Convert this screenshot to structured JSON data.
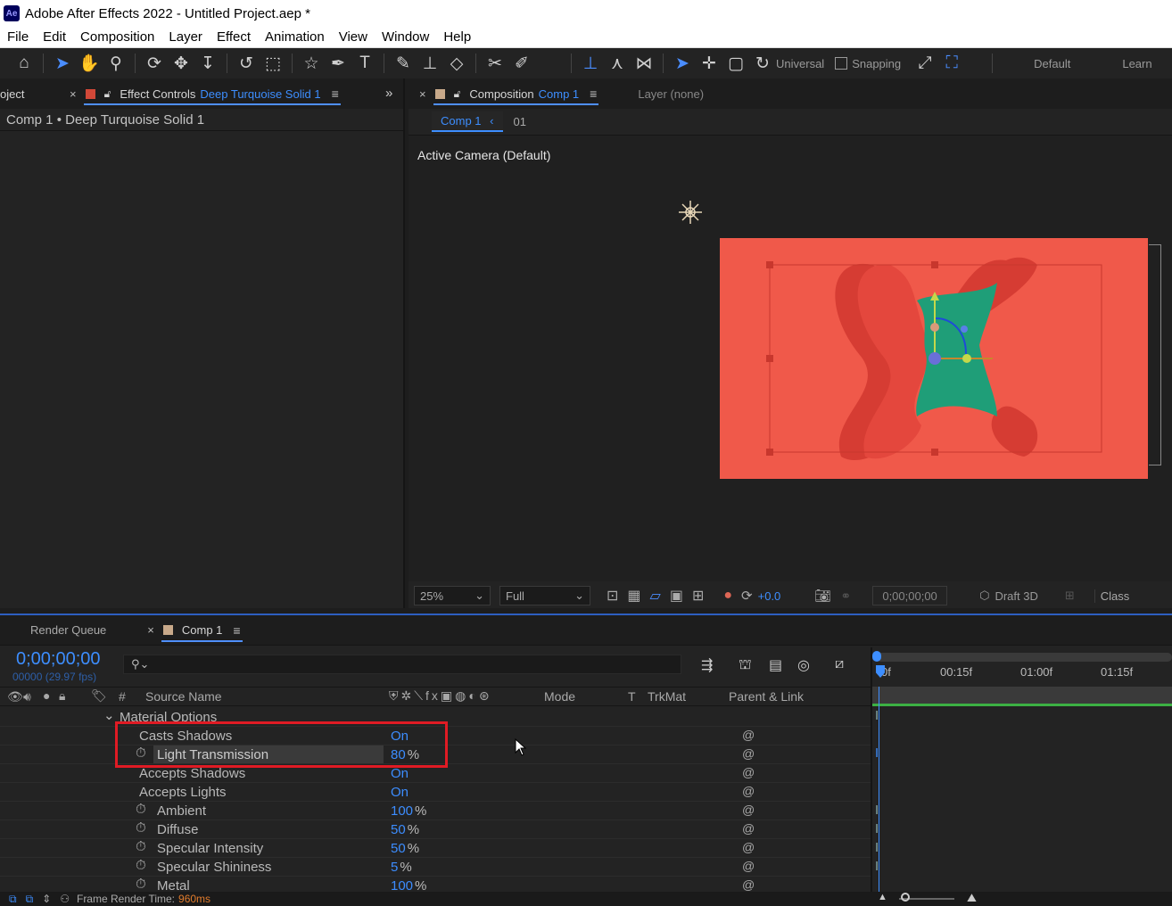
{
  "window": {
    "title": "Adobe After Effects 2022 - Untitled Project.aep *",
    "app_icon": "Ae"
  },
  "menu": [
    "File",
    "Edit",
    "Composition",
    "Layer",
    "Effect",
    "Animation",
    "View",
    "Window",
    "Help"
  ],
  "toolbar": {
    "universal_label": "Universal",
    "snapping_label": "Snapping",
    "workspace": "Default",
    "learn": "Learn"
  },
  "left_panel": {
    "project_tab": "oject",
    "tab_label": "Effect Controls",
    "tab_target": "Deep Turquoise Solid 1",
    "breadcrumb": "Comp 1 • Deep Turquoise Solid 1"
  },
  "comp_panel": {
    "tab_label": "Composition",
    "tab_target": "Comp 1",
    "layer_tab": "Layer (none)",
    "sub_tab": "Comp 1",
    "sub_tab_extra": "01",
    "camera_label": "Active Camera (Default)",
    "zoom": "25%",
    "resolution": "Full",
    "exposure": "+0.0",
    "timecode": "0;00;00;00",
    "renderer": "Draft 3D",
    "classic": "Class"
  },
  "timeline": {
    "render_queue_tab": "Render Queue",
    "comp_tab": "Comp 1",
    "timecode": "0;00;00;00",
    "frame_info": "00000 (29.97 fps)",
    "columns": {
      "hash": "#",
      "source": "Source Name",
      "mode": "Mode",
      "t": "T",
      "trkmat": "TrkMat",
      "parent": "Parent & Link"
    },
    "ruler": [
      "0f",
      "00:15f",
      "01:00f",
      "01:15f"
    ],
    "group_label": "Material Options",
    "properties": [
      {
        "name": "Casts Shadows",
        "value": "On",
        "unit": ""
      },
      {
        "name": "Light Transmission",
        "value": "80",
        "unit": "%"
      },
      {
        "name": "Accepts Shadows",
        "value": "On",
        "unit": ""
      },
      {
        "name": "Accepts Lights",
        "value": "On",
        "unit": ""
      },
      {
        "name": "Ambient",
        "value": "100",
        "unit": "%"
      },
      {
        "name": "Diffuse",
        "value": "50",
        "unit": "%"
      },
      {
        "name": "Specular Intensity",
        "value": "50",
        "unit": "%"
      },
      {
        "name": "Specular Shininess",
        "value": "5",
        "unit": "%"
      },
      {
        "name": "Metal",
        "value": "100",
        "unit": "%"
      }
    ]
  },
  "status": {
    "label": "Frame Render Time:",
    "value": "960ms"
  },
  "colors": {
    "accent": "#4a8dff",
    "comp_bg": "#f0594a",
    "shape_teal": "#1f9e78",
    "highlight_box": "#e01b24",
    "solid_swatch": "#d24838",
    "comp_swatch": "#c8a98a"
  }
}
